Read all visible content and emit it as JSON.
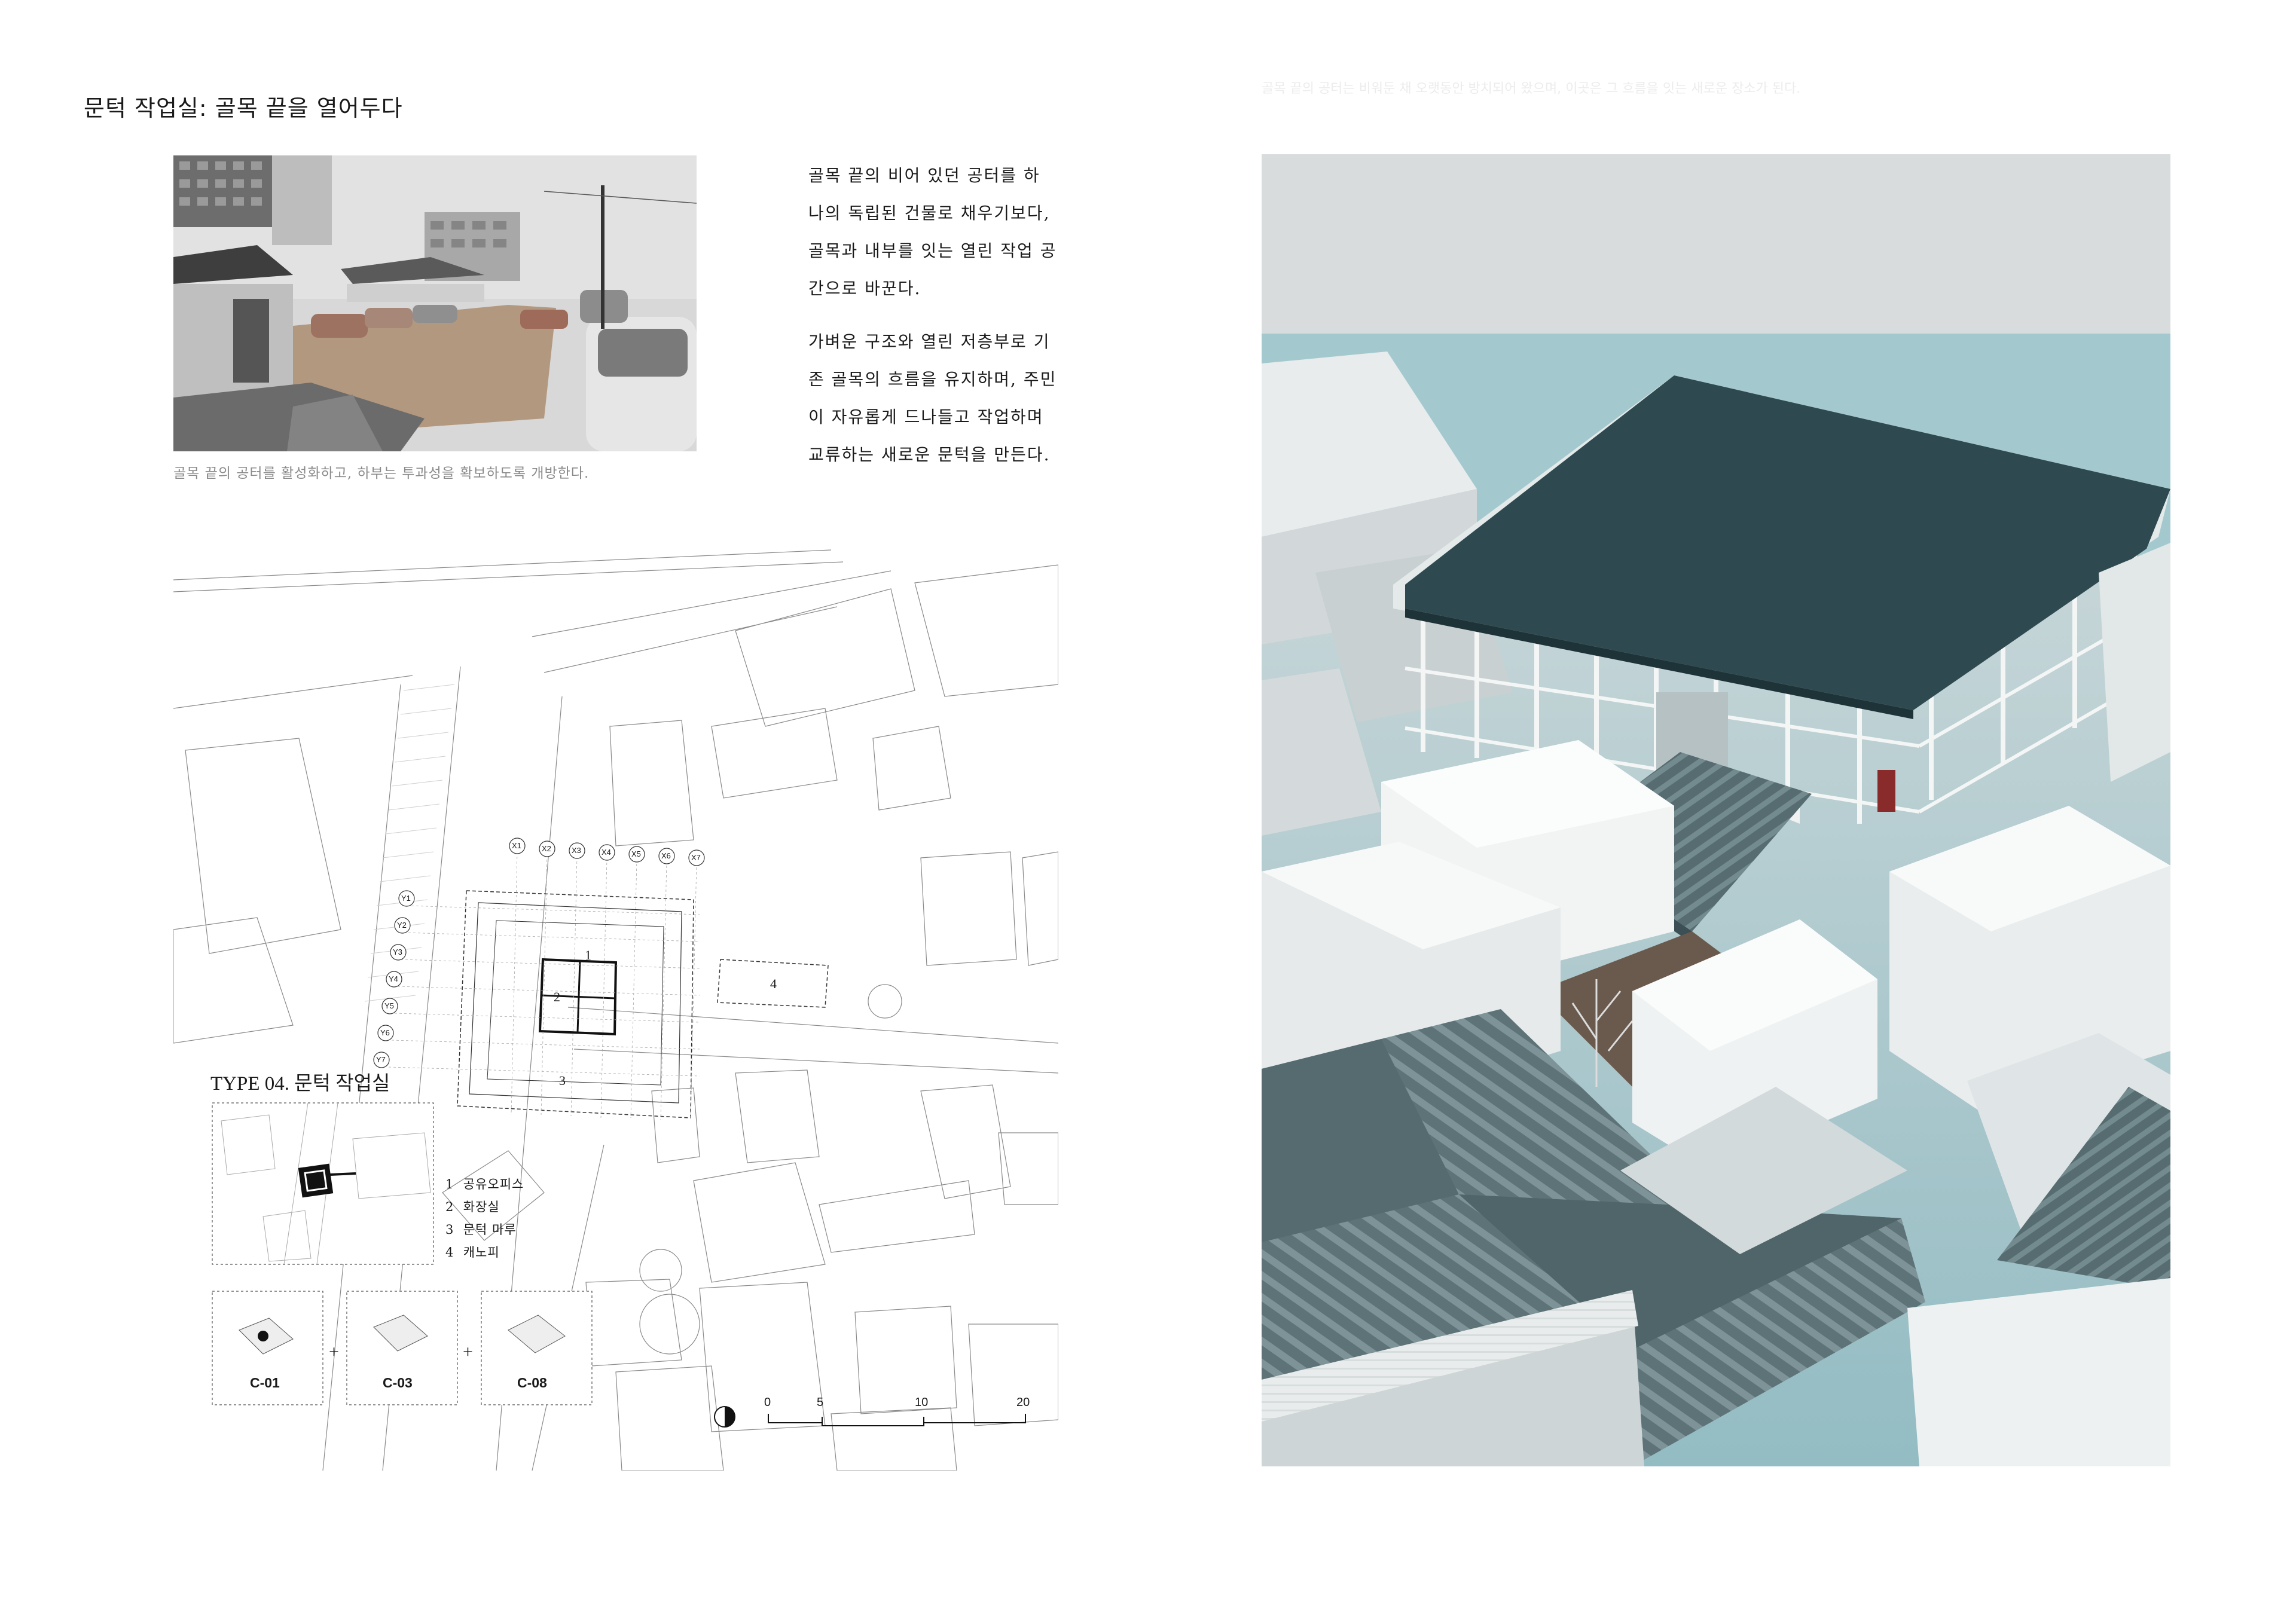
{
  "page": {
    "title": "문턱 작업실: 골목 끝을 열어두다",
    "faint_header": "골목 끝의 공터는 비워둔 채 오랫동안 방치되어 왔으며, 이곳은 그 흐름을 잇는 새로운 장소가 된다."
  },
  "photo": {
    "caption": "골목 끝의 공터를 활성화하고, 하부는 투과성을 확보하도록 개방한다."
  },
  "description": {
    "para1": [
      "골목 끝의 비어  있던 공터를 하",
      "나의 독립된 건물로 채우기보다,",
      "골목과 내부를 잇는 열린 작업 공",
      "간으로 바꾼다."
    ],
    "para2": [
      "가벼운 구조와 열린 저층부로 기",
      "존 골목의 흐름을 유지하며, 주민",
      "이 자유롭게 드나들고 작업하며",
      "교류하는 새로운 문턱을 만든다."
    ]
  },
  "site_plan": {
    "type_label": "TYPE 04.  문턱 작업실",
    "grid_x": [
      "X1",
      "X2",
      "X3",
      "X4",
      "X5",
      "X6",
      "X7"
    ],
    "grid_y": [
      "Y1",
      "Y2",
      "Y3",
      "Y4",
      "Y5",
      "Y6",
      "Y7"
    ],
    "zones": [
      "1",
      "2",
      "3",
      "4"
    ],
    "legend": [
      {
        "num": "1",
        "label": "공유오피스"
      },
      {
        "num": "2",
        "label": "화장실"
      },
      {
        "num": "3",
        "label": "문턱 마루"
      },
      {
        "num": "4",
        "label": "캐노피"
      }
    ],
    "combo": [
      {
        "label": "C-01"
      },
      {
        "label": "C-03"
      },
      {
        "label": "C-08"
      }
    ],
    "plus": "+",
    "scale_ticks": [
      "0",
      "5",
      "10",
      "20"
    ]
  },
  "colors": {
    "roof_dark": "#2e4a50",
    "teal_wall": "#9fc7cf",
    "model_white": "#eef0f0"
  }
}
